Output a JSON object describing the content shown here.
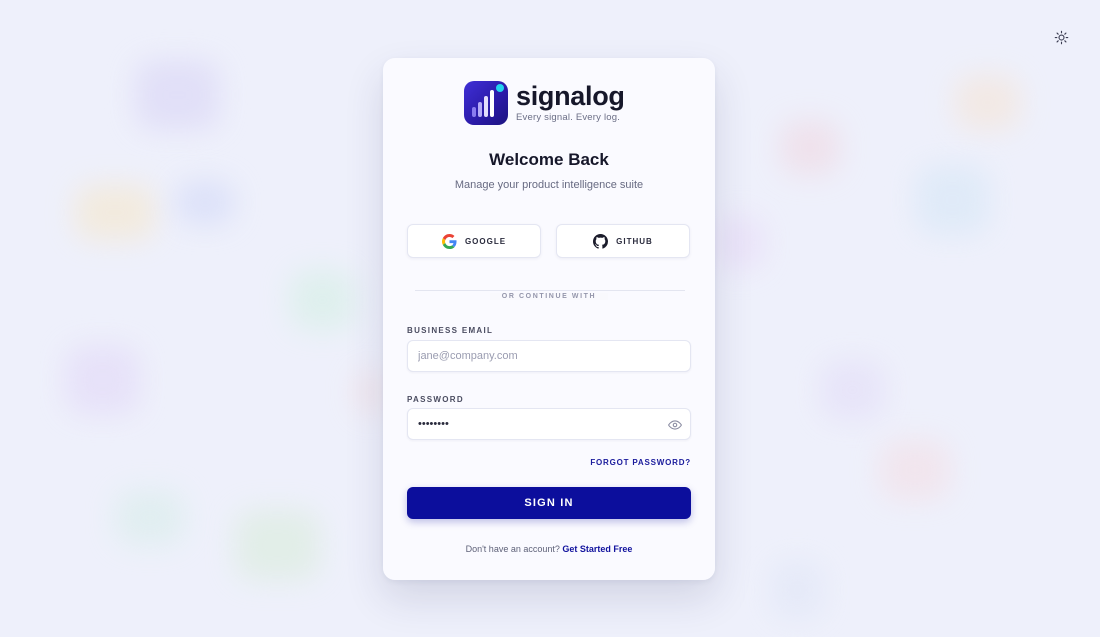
{
  "brand": {
    "name": "signalog",
    "tagline": "Every signal. Every log."
  },
  "header": {
    "title": "Welcome Back",
    "subtitle": "Manage your product intelligence suite"
  },
  "oauth": {
    "google_label": "GOOGLE",
    "github_label": "GITHUB"
  },
  "divider_text": "OR CONTINUE WITH",
  "form": {
    "email_label": "BUSINESS EMAIL",
    "email_placeholder": "jane@company.com",
    "password_label": "PASSWORD",
    "password_value": "••••••••",
    "forgot_label": "FORGOT PASSWORD?",
    "submit_label": "SIGN IN"
  },
  "footer": {
    "prompt": "Don't have an account?",
    "link": "Get Started Free"
  },
  "colors": {
    "accent": "#0c0e9c",
    "logo": "#3f2fd6",
    "logo_dot": "#22d3ee",
    "background": "#eef0fb"
  },
  "icons": {
    "theme_toggle": "sun-icon",
    "google": "google-icon",
    "github": "github-icon",
    "password_visibility": "eye-icon"
  }
}
